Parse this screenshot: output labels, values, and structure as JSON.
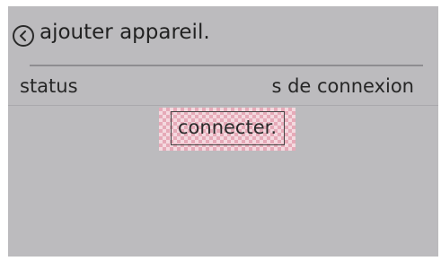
{
  "header": {
    "back_icon": "back-arrow-circle-icon",
    "title": "ajouter appareil."
  },
  "info_row": {
    "status_label": "status",
    "connection_label": "s de connexion"
  },
  "connect_button": {
    "label": "connecter."
  },
  "colors": {
    "screen_bg": "#bcbbbe",
    "button_highlight": "#e6aab8"
  }
}
